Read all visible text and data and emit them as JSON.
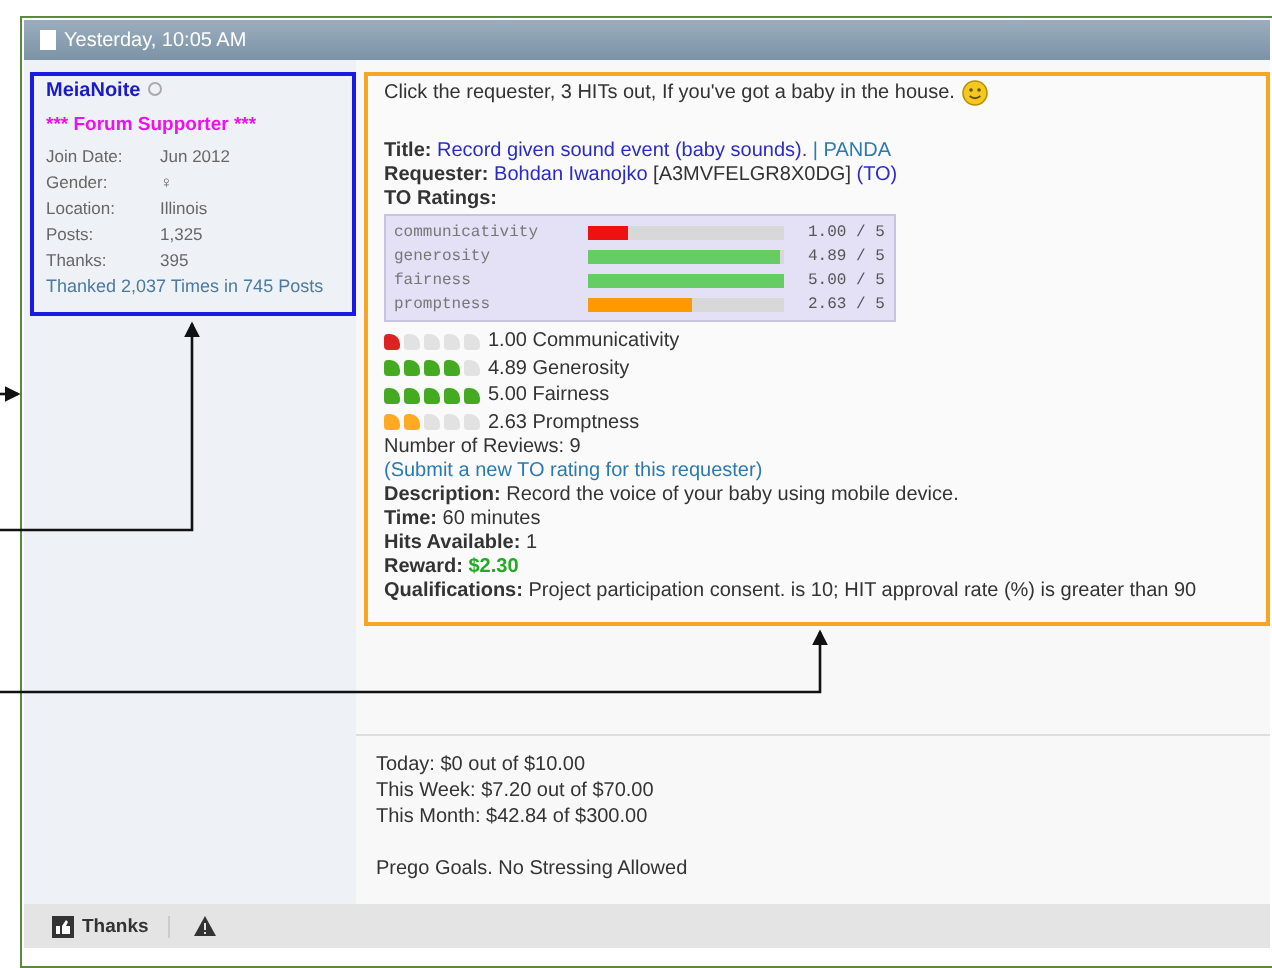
{
  "post": {
    "timestamp": "Yesterday, 10:05 AM"
  },
  "user": {
    "name": "MeiaNoite",
    "online": false,
    "title": "*** Forum Supporter ***",
    "fields": [
      {
        "label": "Join Date:",
        "value": "Jun 2012"
      },
      {
        "label": "Gender:",
        "value": "♀"
      },
      {
        "label": "Location:",
        "value": "Illinois"
      },
      {
        "label": "Posts:",
        "value": "1,325"
      },
      {
        "label": "Thanks:",
        "value": "395"
      }
    ],
    "thanked": "Thanked 2,037 Times in 745 Posts"
  },
  "message": {
    "intro": "Click the requester, 3 HITs out, If you've got a baby in the house.",
    "title_label": "Title:",
    "title_link": "Record given sound event (baby sounds).",
    "title_suffix": "| PANDA",
    "requester_label": "Requester:",
    "requester_link": "Bohdan Iwanojko",
    "requester_id": "[A3MVFELGR8X0DG]",
    "to_link": "(TO)",
    "ratings_label": "TO Ratings:",
    "ratings": [
      {
        "name": "communicativity",
        "level": 0.2,
        "reading": "1.00 / 5",
        "color": "#ee1111"
      },
      {
        "name": "generosity",
        "level": 0.978,
        "reading": "4.89 / 5",
        "color": "#66cc66"
      },
      {
        "name": "fairness",
        "level": 1,
        "reading": "5.00 / 5",
        "color": "#66cc66"
      },
      {
        "name": "promptness",
        "level": 0.526,
        "reading": "2.63 / 5",
        "color": "#ff9900"
      }
    ],
    "star_rows": [
      {
        "stars": 1,
        "text": "1.00 Communicativity",
        "color": "#dd2222"
      },
      {
        "stars": 4,
        "text": "4.89 Generosity",
        "color": "#44aa22"
      },
      {
        "stars": 5,
        "text": "5.00 Fairness",
        "color": "#44aa22"
      },
      {
        "stars": 2,
        "text": "2.63 Promptness",
        "color": "#ffaa22"
      }
    ],
    "reviews": "Number of Reviews: 9",
    "submit_link": "(Submit a new TO rating for this requester)",
    "details": [
      {
        "label": "Description:",
        "value": "Record the voice of your baby using mobile device.",
        "kind": "plain"
      },
      {
        "label": "Time:",
        "value": "60 minutes",
        "kind": "plain"
      },
      {
        "label": "Hits Available:",
        "value": "1",
        "kind": "plain"
      },
      {
        "label": "Reward:",
        "value": "$2.30",
        "kind": "money"
      },
      {
        "label": "Qualifications:",
        "value": "Project participation consent. is 10; HIT approval rate (%) is greater than 90",
        "kind": "plain"
      }
    ]
  },
  "signature": {
    "lines": [
      "Today: $0 out of $10.00",
      "This Week: $7.20 out of $70.00",
      "This Month: $42.84 of $300.00"
    ],
    "motto": "Prego Goals. No Stressing Allowed"
  },
  "footer": {
    "thanks_button": "Thanks"
  }
}
